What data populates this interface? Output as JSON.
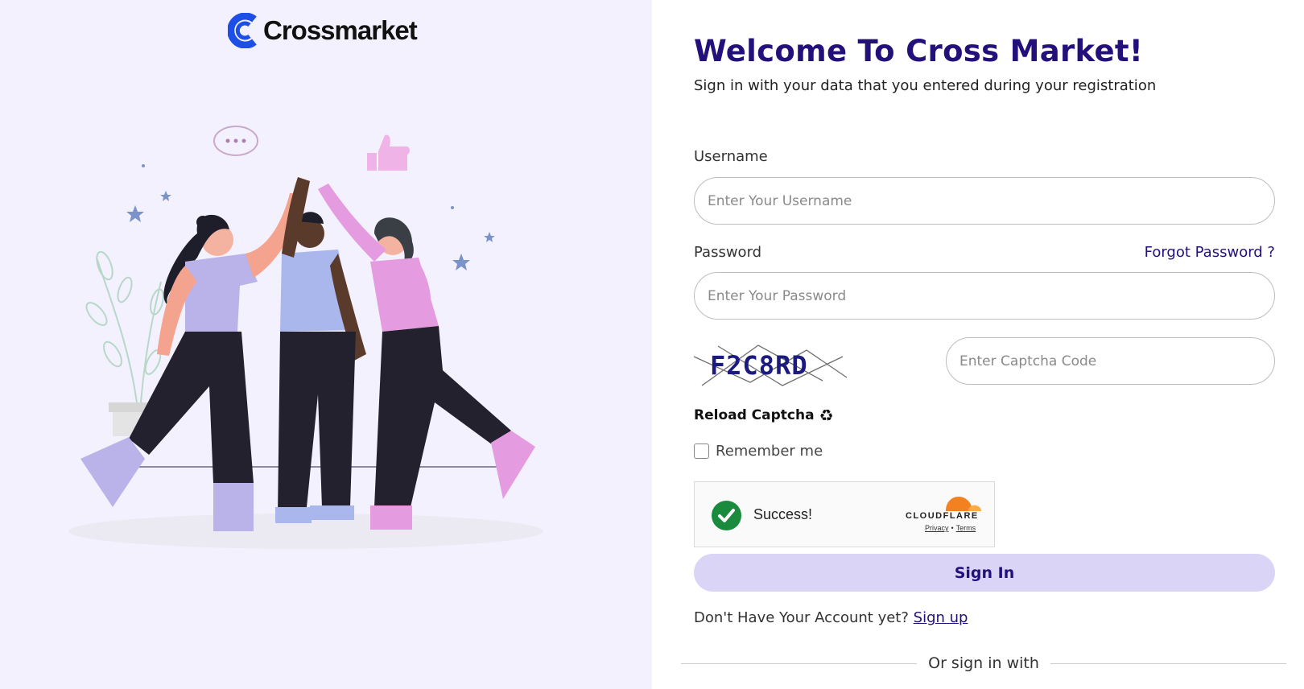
{
  "brand": {
    "name": "Crossmarket",
    "color": "#1d4ee6"
  },
  "colors": {
    "accent": "#24107a",
    "button_bg": "#dad5f6",
    "left_bg": "#f3f1fd",
    "success": "#1a8a3d",
    "cloudflare_orange": "#f48120"
  },
  "header": {
    "title": "Welcome To Cross Market!",
    "subtitle": "Sign in with your data that you entered during your registration"
  },
  "form": {
    "username": {
      "label": "Username",
      "placeholder": "Enter Your Username",
      "value": ""
    },
    "password": {
      "label": "Password",
      "placeholder": "Enter Your Password",
      "value": "",
      "forgot_label": "Forgot Password ?"
    },
    "captcha": {
      "code": "F2C8RD",
      "placeholder": "Enter Captcha Code",
      "value": "",
      "reload_label": "Reload Captcha",
      "reload_icon": "recycle-icon"
    },
    "remember": {
      "label": "Remember me",
      "checked": false
    },
    "turnstile": {
      "status": "Success!",
      "provider": "CLOUDFLARE",
      "privacy": "Privacy",
      "separator": "•",
      "terms": "Terms"
    },
    "submit_label": "Sign In"
  },
  "footer": {
    "signup_prompt": "Don't Have Your Account yet?",
    "signup_link": "Sign up",
    "alt_signin": "Or sign in with"
  }
}
